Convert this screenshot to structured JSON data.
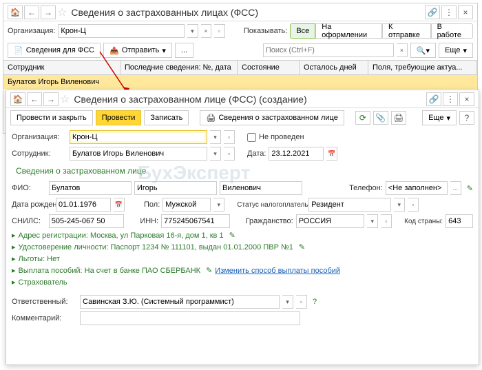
{
  "w1": {
    "title": "Сведения о застрахованных лицах (ФСС)",
    "org_label": "Организация:",
    "org_value": "Крон-Ц",
    "show_label": "Показывать:",
    "filter_all": "Все",
    "filter_draft": "На оформлении",
    "filter_send": "К отправке",
    "filter_work": "В работе",
    "btn_info": "Сведения для ФСС",
    "btn_send": "Отправить",
    "search_placeholder": "Поиск (Ctrl+F)",
    "btn_more": "Еще",
    "col1": "Сотрудник",
    "col2": "Последние сведения: №, дата",
    "col3": "Состояние",
    "col4": "Осталось дней",
    "col5": "Поля, требующие актуа...",
    "row1": "Булатов Игорь Виленович"
  },
  "w2": {
    "title": "Сведения о застрахованном лице (ФСС) (создание)",
    "btn_post_close": "Провести и закрыть",
    "btn_post": "Провести",
    "btn_save": "Записать",
    "btn_info": "Сведения о застрахованном лице",
    "btn_more": "Еще",
    "org_label": "Организация:",
    "org_value": "Крон-Ц",
    "not_posted": "Не проведен",
    "emp_label": "Сотрудник:",
    "emp_value": "Булатов Игорь Виленович",
    "date_label": "Дата:",
    "date_value": "23.12.2021",
    "section": "Сведения о застрахованном лице",
    "fio_label": "ФИО:",
    "fio_last": "Булатов",
    "fio_first": "Игорь",
    "fio_mid": "Виленович",
    "phone_label": "Телефон:",
    "phone_value": "<Не заполнен>",
    "birth_label": "Дата рождения:",
    "birth_value": "01.01.1976",
    "sex_label": "Пол:",
    "sex_value": "Мужской",
    "tax_label": "Статус налогоплательщика:",
    "tax_value": "Резидент",
    "snils_label": "СНИЛС:",
    "snils_value": "505-245-067 50",
    "inn_label": "ИНН:",
    "inn_value": "775245067541",
    "cit_label": "Гражданство:",
    "cit_value": "РОССИЯ",
    "code_label": "Код страны:",
    "code_value": "643",
    "addr": "Адрес регистрации: Москва, ул Парковая 16-я, дом 1, кв 1",
    "doc": "Удостоверение личности: Паспорт 1234 № 111101, выдан 01.01.2000 ПВР №1",
    "benefits": "Льготы: Нет",
    "pay": "Выплата пособий: На счет в банке ПАО СБЕРБАНК",
    "pay_link": "Изменить способ выплаты пособий",
    "insurer": "Страхователь",
    "resp_label": "Ответственный:",
    "resp_value": "Савинская З.Ю. (Системный программист)",
    "comment_label": "Комментарий:"
  }
}
